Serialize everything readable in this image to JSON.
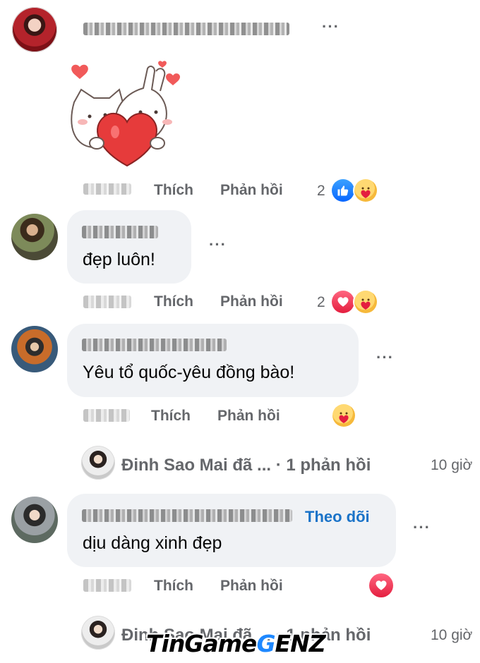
{
  "comments": [
    {
      "time": "",
      "like_label": "Thích",
      "reply_label": "Phản hồi",
      "reaction_count": "2",
      "reactions": [
        "like-icon",
        "care-icon"
      ],
      "sticker": "cat-bunny-heart-sticker"
    },
    {
      "text": "đẹp luôn!",
      "like_label": "Thích",
      "reply_label": "Phản hồi",
      "reaction_count": "2",
      "reactions": [
        "love-icon",
        "care-icon"
      ]
    },
    {
      "text": "Yêu tổ quốc-yêu đồng bào!",
      "like_label": "Thích",
      "reply_label": "Phản hồi",
      "reactions": [
        "care-icon"
      ],
      "replies_summary": {
        "name": "Đinh Sao Mai đã ...",
        "separator": "·",
        "count_label": "1 phản hồi",
        "time": "10 giờ"
      }
    },
    {
      "follow_label": "Theo dõi",
      "text": "dịu dàng xinh đẹp",
      "like_label": "Thích",
      "reply_label": "Phản hồi",
      "reactions": [
        "love-icon"
      ],
      "replies_summary": {
        "name": "Đinh Sao Mai đã ...",
        "separator": "·",
        "count_label": "1 phản hồi",
        "time": "10 giờ"
      }
    }
  ],
  "more_label": "···",
  "watermark": {
    "part1": "TinGame",
    "part2": "G",
    "part3": "ENZ"
  },
  "colors": {
    "meta": "#65676b",
    "bubble": "#f0f2f5",
    "like": "#0866ff",
    "love": "#e41e3f",
    "link": "#1a73c8"
  }
}
